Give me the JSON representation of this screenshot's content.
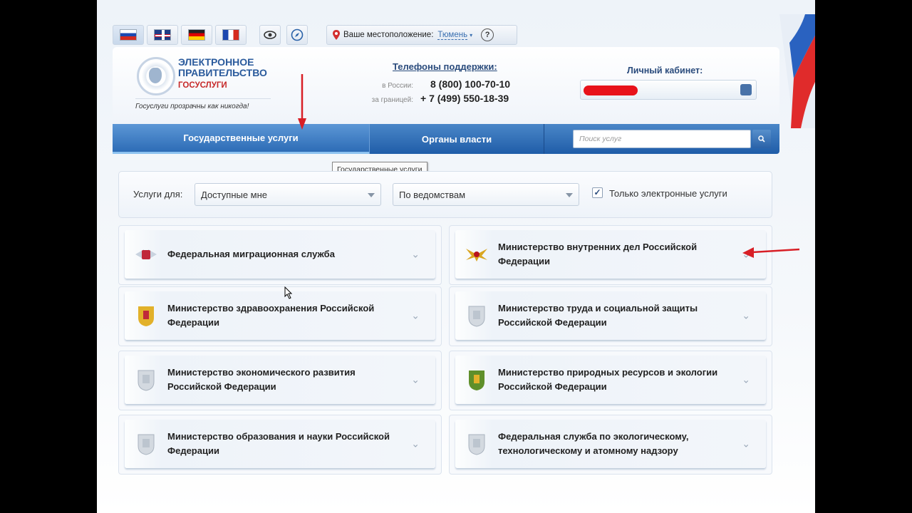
{
  "flags": [
    {
      "name": "flag-ru-icon",
      "active": true,
      "cls": "f-ru"
    },
    {
      "name": "flag-uk-icon",
      "active": false,
      "cls": "f-en"
    },
    {
      "name": "flag-de-icon",
      "active": false,
      "cls": "f-de"
    },
    {
      "name": "flag-fr-icon",
      "active": false,
      "cls": "f-fr"
    }
  ],
  "location": {
    "label": "Ваше местоположение:",
    "city": "Тюмень",
    "help": "?"
  },
  "logo": {
    "line1": "ЭЛЕКТРОННОЕ",
    "line2": "ПРАВИТЕЛЬСТВО",
    "line3": "ГОСУСЛУГИ",
    "slogan": "Госуслуги прозрачны как никогда!"
  },
  "support": {
    "title": "Телефоны поддержки:",
    "russia_label": "в России:",
    "russia_number": "8 (800) 100-70-10",
    "abroad_label": "за границей:",
    "abroad_number": "+ 7 (499) 550-18-39"
  },
  "cabinet": {
    "title": "Личный кабинет:"
  },
  "nav": {
    "tab1": "Государственные услуги",
    "tab2": "Органы власти",
    "search_placeholder": "Поиск услуг"
  },
  "tooltip": "Государственные услуги",
  "filter": {
    "label": "Услуги для:",
    "select1": "Доступные мне",
    "select2": "По ведомствам",
    "checkbox_label": "Только электронные услуги",
    "checked": true
  },
  "cards": [
    {
      "title": "Федеральная миграционная служба",
      "emblem": "fms"
    },
    {
      "title": "Министерство внутренних дел Российской Федерации",
      "emblem": "mvd"
    },
    {
      "title": "Министерство здравоохранения Российской Федерации",
      "emblem": "gold"
    },
    {
      "title": "Министерство труда и социальной защиты Российской Федерации",
      "emblem": "grey"
    },
    {
      "title": "Министерство экономического развития Российской Федерации",
      "emblem": "grey"
    },
    {
      "title": "Министерство природных ресурсов и экологии Российской Федерации",
      "emblem": "green"
    },
    {
      "title": "Министерство образования и науки Российской Федерации",
      "emblem": "grey"
    },
    {
      "title": "Федеральная служба по экологическому, технологическому и атомному надзору",
      "emblem": "grey"
    }
  ],
  "colors": {
    "accent": "#1f5da8",
    "brand_red": "#c62828",
    "annotation_arrow": "#d81f26"
  }
}
